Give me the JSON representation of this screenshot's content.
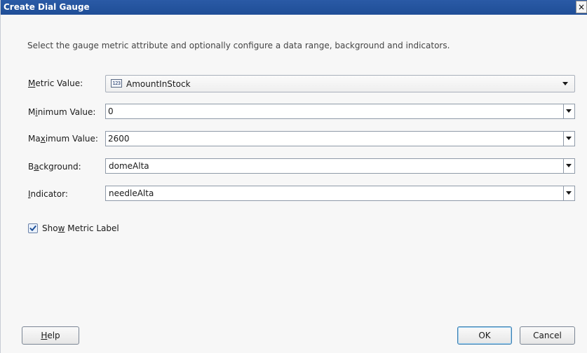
{
  "window": {
    "title": "Create Dial Gauge",
    "close_glyph": "×"
  },
  "instructions": "Select the gauge metric attribute and optionally configure a data range, background and indicators.",
  "fields": {
    "metric_value": {
      "label_prefix": "",
      "label_mnemonic": "M",
      "label_rest": "etric Value:",
      "value": "AmountInStock",
      "icon_text": "123"
    },
    "minimum_value": {
      "label_prefix": "M",
      "label_mnemonic": "i",
      "label_rest": "nimum Value:",
      "value": "0"
    },
    "maximum_value": {
      "label_prefix": "Ma",
      "label_mnemonic": "x",
      "label_rest": "imum Value:",
      "value": "2600"
    },
    "background": {
      "label_prefix": "B",
      "label_mnemonic": "a",
      "label_rest": "ckground:",
      "value": "domeAlta"
    },
    "indicator": {
      "label_prefix": "",
      "label_mnemonic": "I",
      "label_rest": "ndicator:",
      "value": "needleAlta"
    }
  },
  "show_metric_label": {
    "checked": true,
    "label_prefix": "Sho",
    "label_mnemonic": "w",
    "label_rest": " Metric Label"
  },
  "buttons": {
    "help_prefix": "",
    "help_mnemonic": "H",
    "help_rest": "elp",
    "ok": "OK",
    "cancel": "Cancel"
  },
  "icons": {
    "close": "close-icon",
    "dropdown": "chevron-down-icon",
    "numeric": "numeric-attribute-icon",
    "check": "checkmark-icon"
  }
}
